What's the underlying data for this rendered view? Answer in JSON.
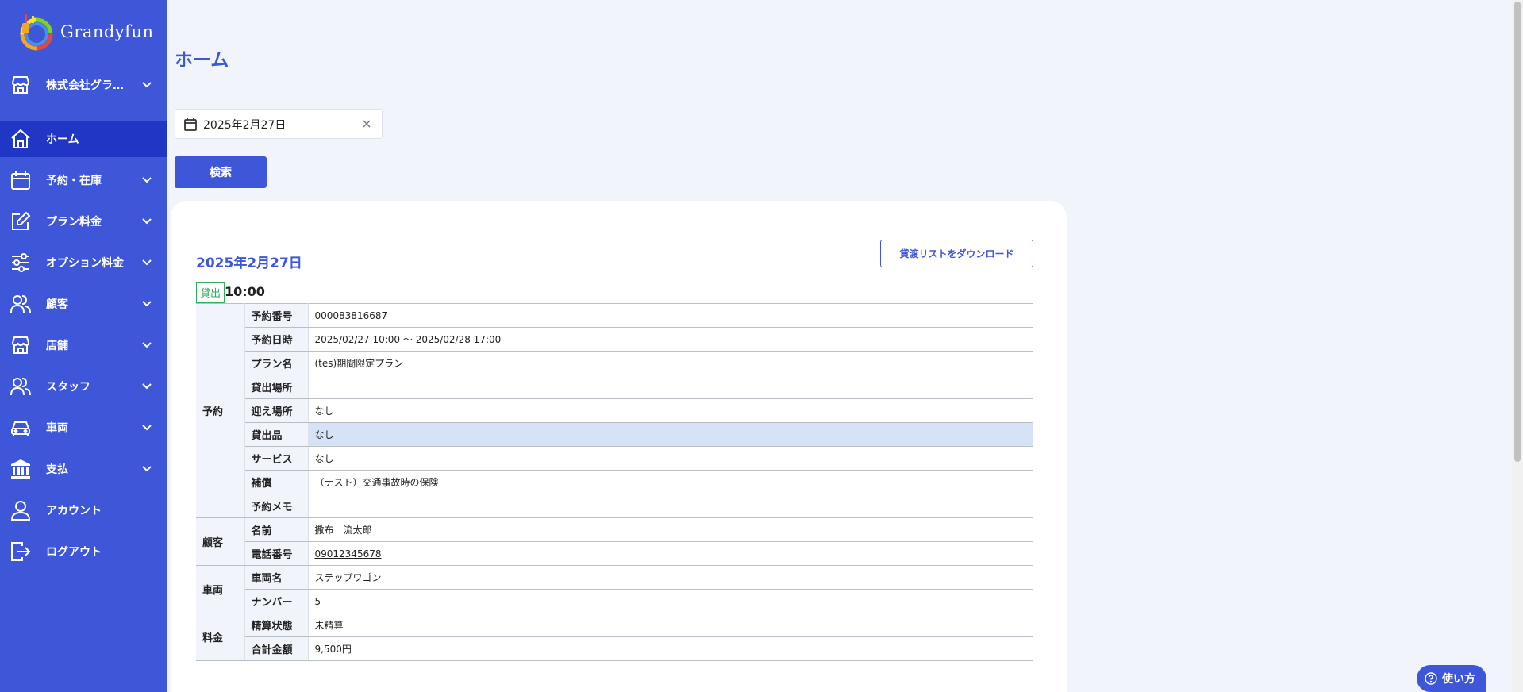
{
  "app": {
    "name": "Grandyfun",
    "logo_icon": "grandyfun-logo-icon"
  },
  "sidebar": {
    "items": [
      {
        "label": "株式会社グラ…",
        "icon": "store-icon",
        "has_chevron": true,
        "active": false
      },
      {
        "label": "ホーム",
        "icon": "home-icon",
        "has_chevron": false,
        "active": true
      },
      {
        "label": "予約・在庫",
        "icon": "calendar-icon",
        "has_chevron": true,
        "active": false
      },
      {
        "label": "プラン料金",
        "icon": "edit-icon",
        "has_chevron": true,
        "active": false
      },
      {
        "label": "オプション料金",
        "icon": "sliders-icon",
        "has_chevron": true,
        "active": false
      },
      {
        "label": "顧客",
        "icon": "users-icon",
        "has_chevron": true,
        "active": false
      },
      {
        "label": "店舗",
        "icon": "store-icon",
        "has_chevron": true,
        "active": false
      },
      {
        "label": "スタッフ",
        "icon": "users-icon",
        "has_chevron": true,
        "active": false
      },
      {
        "label": "車両",
        "icon": "car-icon",
        "has_chevron": true,
        "active": false
      },
      {
        "label": "支払",
        "icon": "bank-icon",
        "has_chevron": true,
        "active": false
      },
      {
        "label": "アカウント",
        "icon": "user-icon",
        "has_chevron": false,
        "active": false
      },
      {
        "label": "ログアウト",
        "icon": "logout-icon",
        "has_chevron": false,
        "active": false
      }
    ]
  },
  "main": {
    "title": "ホーム",
    "date_input": {
      "value": "2025年2月27日",
      "icon": "calendar-icon",
      "clear_icon": "close-icon"
    },
    "search_button": "検索",
    "card": {
      "date": "2025年2月27日",
      "download_button": "貸渡リストをダウンロード",
      "badge": "貸出",
      "time": "10:00",
      "groups": [
        {
          "label": "予約",
          "rows": [
            {
              "label": "予約番号",
              "value": "000083816687"
            },
            {
              "label": "予約日時",
              "value": "2025/02/27 10:00 ～ 2025/02/28 17:00"
            },
            {
              "label": "プラン名",
              "value": "(tes)期間限定プラン"
            },
            {
              "label": "貸出場所",
              "value": ""
            },
            {
              "label": "迎え場所",
              "value": "なし"
            },
            {
              "label": "貸出品",
              "value": "なし",
              "highlight": true
            },
            {
              "label": "サービス",
              "value": "なし"
            },
            {
              "label": "補償",
              "value": "（テスト）交通事故時の保険"
            },
            {
              "label": "予約メモ",
              "value": ""
            }
          ]
        },
        {
          "label": "顧客",
          "rows": [
            {
              "label": "名前",
              "value": "撒布　流太郎"
            },
            {
              "label": "電話番号",
              "value": "09012345678",
              "link": true
            }
          ]
        },
        {
          "label": "車両",
          "rows": [
            {
              "label": "車両名",
              "value": "ステップワゴン"
            },
            {
              "label": "ナンバー",
              "value": "5"
            }
          ]
        },
        {
          "label": "料金",
          "rows": [
            {
              "label": "精算状態",
              "value": "未精算"
            },
            {
              "label": "合計金額",
              "value": "9,500円"
            }
          ]
        }
      ]
    }
  },
  "help_button": {
    "label": "使い方",
    "icon": "help-icon"
  },
  "colors": {
    "primary": "#3d57d8",
    "active_nav": "#1f37c4",
    "badge_green": "#2fae5f",
    "highlight_row": "#d6e3f7",
    "background": "#f1f4fb"
  }
}
